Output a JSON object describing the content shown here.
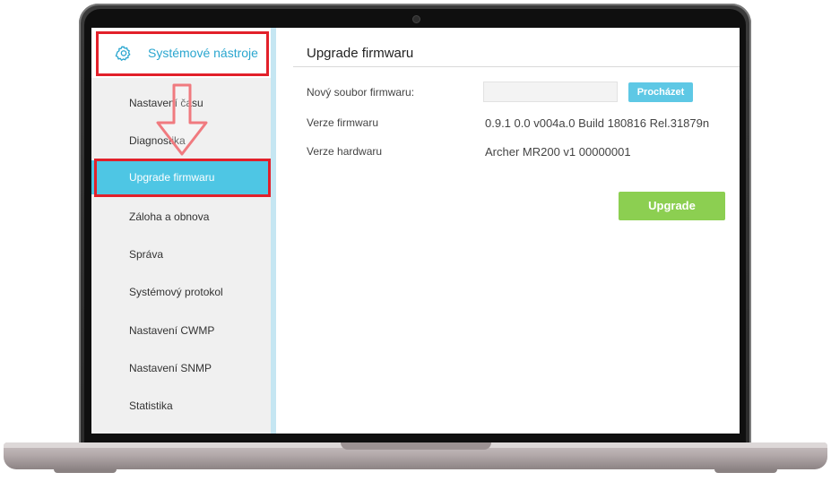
{
  "sidebar": {
    "header_title": "Systémové nástroje",
    "header_icon": "gear-icon",
    "items": [
      {
        "label": "Nastavení času",
        "active": false
      },
      {
        "label": "Diagnostika",
        "active": false
      },
      {
        "label": "Upgrade firmwaru",
        "active": true
      },
      {
        "label": "Záloha a obnova",
        "active": false
      },
      {
        "label": "Správa",
        "active": false
      },
      {
        "label": "Systémový protokol",
        "active": false
      },
      {
        "label": "Nastavení CWMP",
        "active": false
      },
      {
        "label": "Nastavení SNMP",
        "active": false
      },
      {
        "label": "Statistika",
        "active": false
      }
    ]
  },
  "main": {
    "title": "Upgrade firmwaru",
    "new_file_label": "Nový soubor firmwaru:",
    "new_file_value": "",
    "browse_label": "Procházet",
    "firmware_label": "Verze firmwaru",
    "firmware_value": "0.9.1 0.0 v004a.0 Build 180816 Rel.31879n",
    "hardware_label": "Verze hardwaru",
    "hardware_value": "Archer MR200 v1 00000001",
    "upgrade_label": "Upgrade"
  },
  "colors": {
    "accent": "#2aa6cf",
    "active_item": "#4ec6e4",
    "upgrade_button": "#8ccf51",
    "highlight": "#e2202a"
  }
}
